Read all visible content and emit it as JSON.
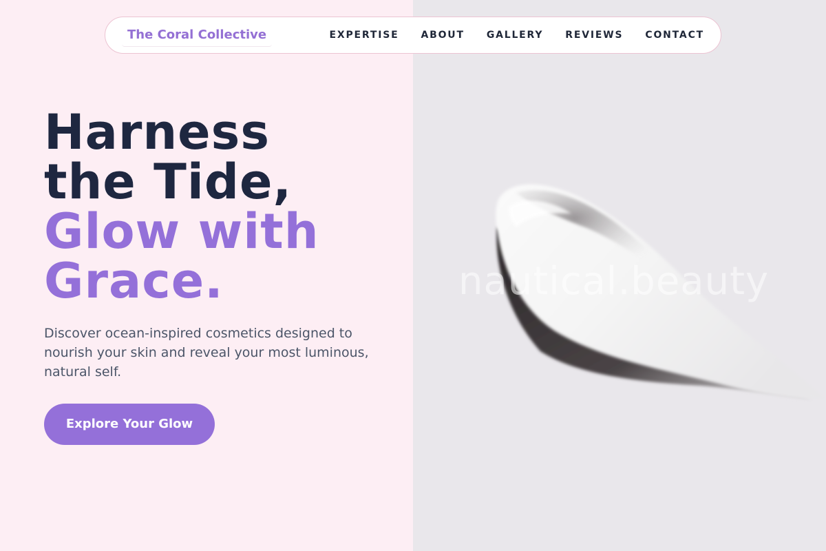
{
  "brand": {
    "name": "The Coral Collective"
  },
  "nav": {
    "links": [
      {
        "label": "EXPERTISE"
      },
      {
        "label": "ABOUT"
      },
      {
        "label": "GALLERY"
      },
      {
        "label": "REVIEWS"
      },
      {
        "label": "CONTACT"
      }
    ]
  },
  "hero": {
    "headline_dark_1": "Harness",
    "headline_dark_2": "the Tide,",
    "headline_accent_1": "Glow with",
    "headline_accent_2": "Grace.",
    "subtext": "Discover ocean-inspired cosmetics designed to nourish your skin and reveal your most luminous, natural self.",
    "cta_label": "Explore Your Glow"
  },
  "image": {
    "watermark": "nautical.beauty",
    "subject": "cream-swatch"
  },
  "colors": {
    "accent": "#9470d9",
    "heading": "#1e2740",
    "left_bg": "#fdeef4",
    "right_bg": "#e9e7eb"
  }
}
